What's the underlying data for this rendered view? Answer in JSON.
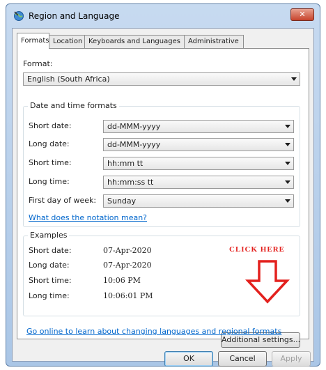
{
  "window": {
    "title": "Region and Language",
    "close_glyph": "✕"
  },
  "tabs": [
    {
      "label": "Formats",
      "active": true
    },
    {
      "label": "Location",
      "active": false
    },
    {
      "label": "Keyboards and Languages",
      "active": false
    },
    {
      "label": "Administrative",
      "active": false
    }
  ],
  "format": {
    "label": "Format:",
    "value": "English (South Africa)"
  },
  "date_time": {
    "group_title": "Date and time formats",
    "rows": [
      {
        "label": "Short date:",
        "value": "dd-MMM-yyyy"
      },
      {
        "label": "Long date:",
        "value": "dd-MMM-yyyy"
      },
      {
        "label": "Short time:",
        "value": "hh:mm tt"
      },
      {
        "label": "Long time:",
        "value": "hh:mm:ss tt"
      },
      {
        "label": "First day of week:",
        "value": "Sunday"
      }
    ],
    "notation_link": "What does the notation mean?"
  },
  "examples": {
    "group_title": "Examples",
    "rows": [
      {
        "label": "Short date:",
        "value": "07-Apr-2020"
      },
      {
        "label": "Long date:",
        "value": "07-Apr-2020"
      },
      {
        "label": "Short time:",
        "value": "10:06 PM"
      },
      {
        "label": "Long time:",
        "value": "10:06:01 PM"
      }
    ]
  },
  "annotation": {
    "text": "CLICK HERE",
    "color": "#e3201d"
  },
  "additional_settings_button": "Additional settings...",
  "online_link": "Go online to learn about changing languages and regional formats",
  "footer": {
    "ok": "OK",
    "cancel": "Cancel",
    "apply": "Apply"
  }
}
